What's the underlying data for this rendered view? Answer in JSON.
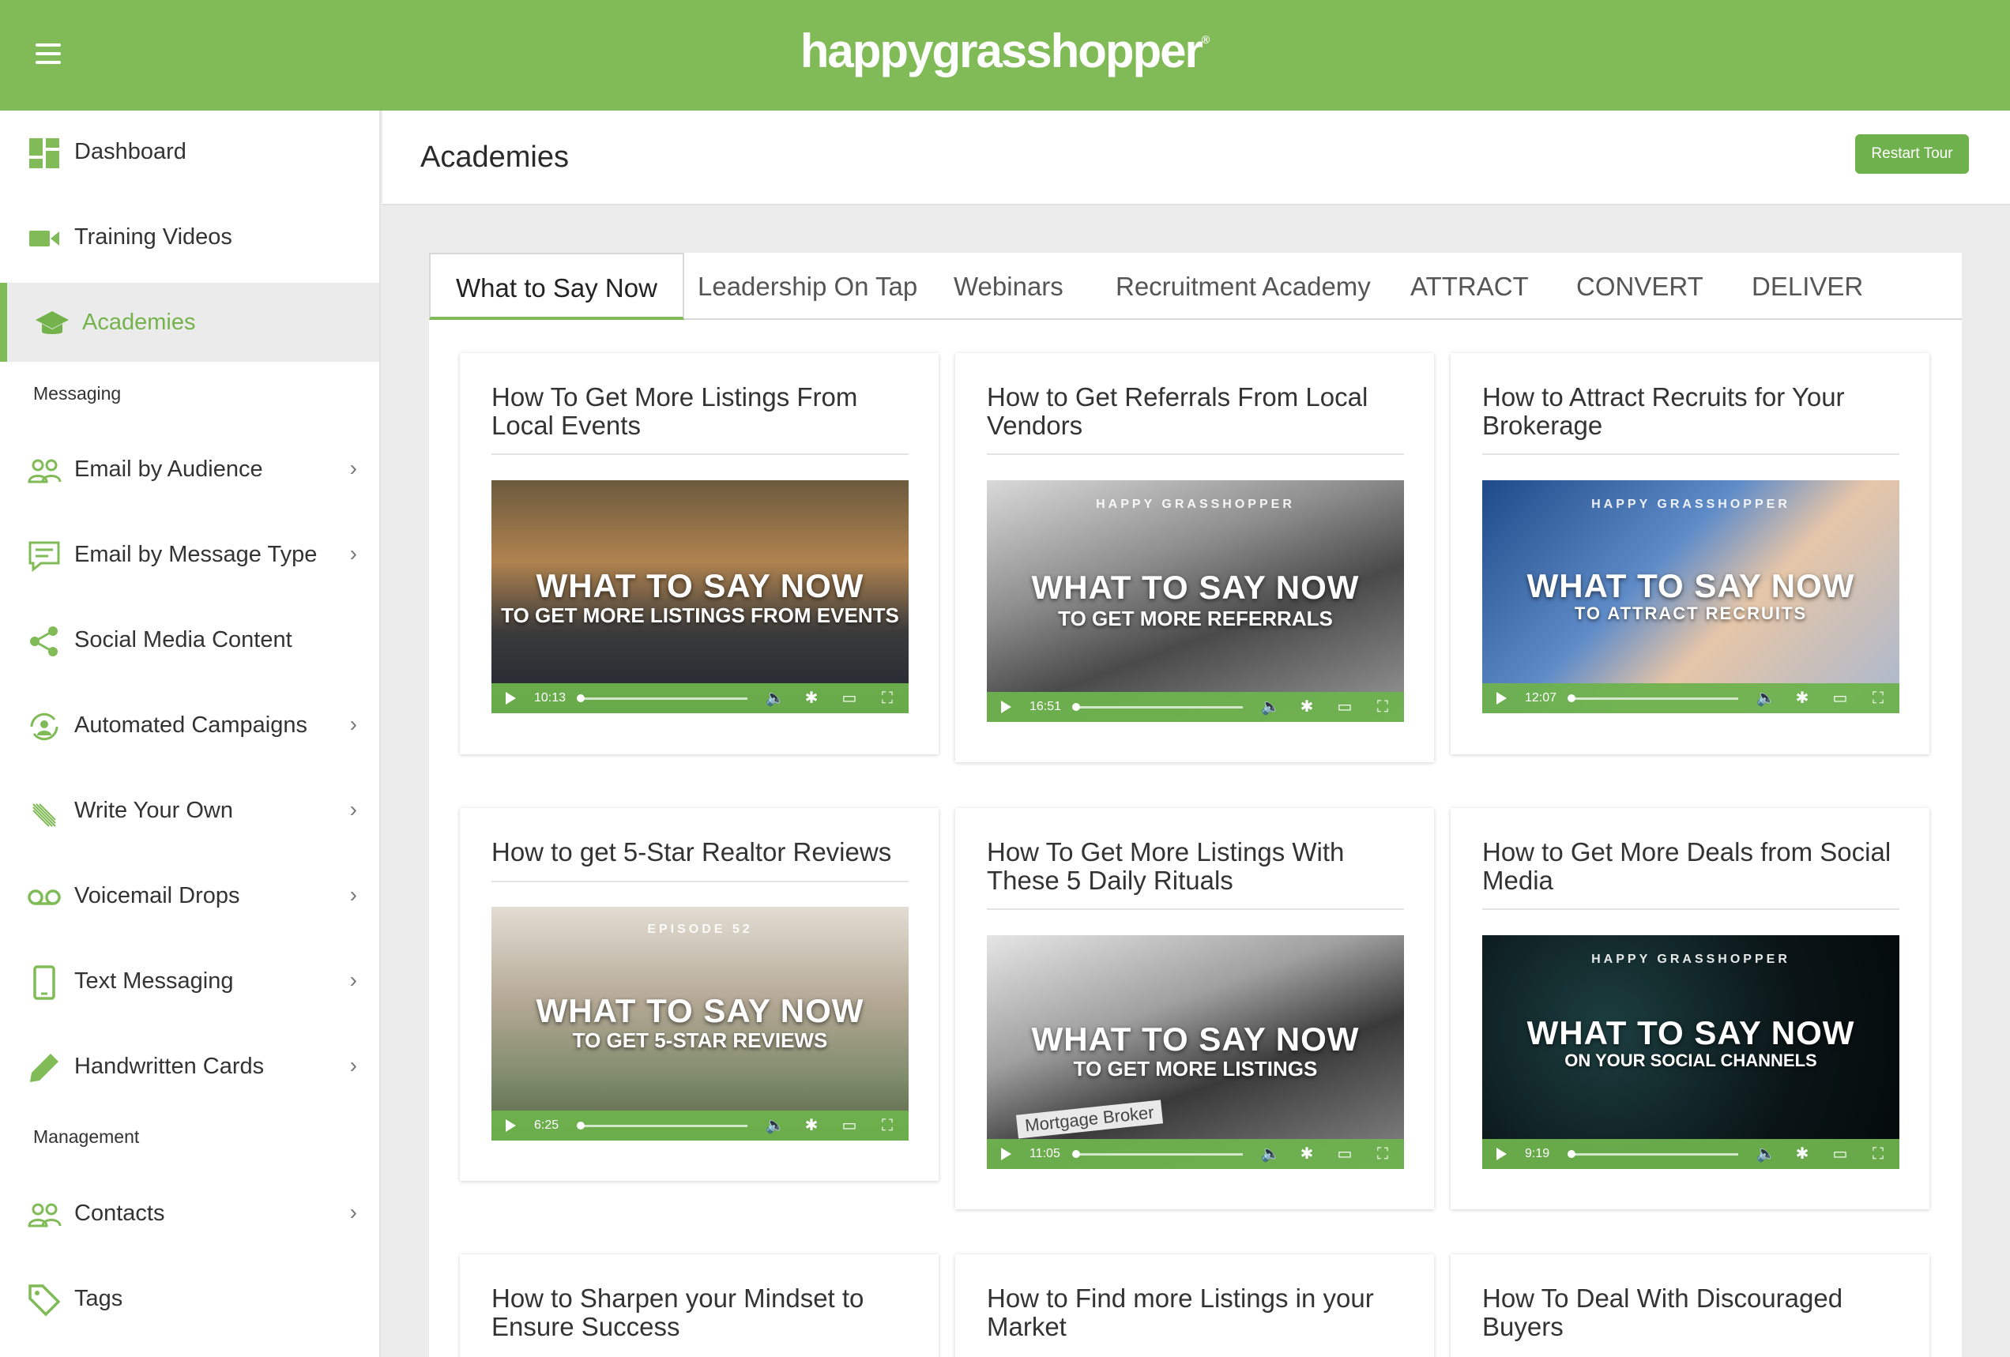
{
  "app": {
    "logo_text": "happygrasshopper",
    "logo_mark": "®"
  },
  "sidebar": {
    "items": [
      {
        "label": "Dashboard",
        "icon": "dashboard-icon"
      },
      {
        "label": "Training Videos",
        "icon": "video-camera-icon"
      },
      {
        "label": "Academies",
        "icon": "graduation-cap-icon",
        "active": true
      },
      {
        "label": "Email by Audience",
        "icon": "people-icon",
        "chevron": true
      },
      {
        "label": "Email by Message Type",
        "icon": "message-icon",
        "chevron": true
      },
      {
        "label": "Social Media Content",
        "icon": "share-icon"
      },
      {
        "label": "Automated Campaigns",
        "icon": "refresh-person-icon",
        "chevron": true
      },
      {
        "label": "Write Your Own",
        "icon": "quill-icon",
        "chevron": true
      },
      {
        "label": "Voicemail Drops",
        "icon": "voicemail-icon",
        "chevron": true
      },
      {
        "label": "Text Messaging",
        "icon": "phone-icon",
        "chevron": true
      },
      {
        "label": "Handwritten Cards",
        "icon": "pen-icon",
        "chevron": true
      },
      {
        "label": "Contacts",
        "icon": "people-icon",
        "chevron": true
      },
      {
        "label": "Tags",
        "icon": "tag-icon"
      }
    ],
    "sections": {
      "messaging": "Messaging",
      "management": "Management"
    },
    "chevron_glyph": "›"
  },
  "header": {
    "title": "Academies",
    "restart_label": "Restart Tour"
  },
  "tabs": [
    "What to Say Now",
    "Leadership On Tap",
    "Webinars",
    "Recruitment Academy",
    "ATTRACT",
    "CONVERT",
    "DELIVER"
  ],
  "colors": {
    "brand_green": "#80bb58",
    "button_green": "#6fb24d"
  },
  "cards": [
    {
      "title": "How To Get More Listings From Local Events",
      "thumb_brand": "",
      "thumb_big": "WHAT TO SAY NOW",
      "thumb_sub": "TO GET MORE LISTINGS FROM EVENTS",
      "duration": "10:13"
    },
    {
      "title": "How to Get Referrals From Local Vendors",
      "thumb_brand": "HAPPY GRASSHOPPER",
      "thumb_big": "WHAT TO SAY NOW",
      "thumb_sub": "TO GET MORE REFERRALS",
      "duration": "16:51"
    },
    {
      "title": "How to Attract Recruits for Your Brokerage",
      "thumb_brand": "HAPPY GRASSHOPPER",
      "thumb_big": "WHAT TO SAY NOW",
      "thumb_sub": "TO ATTRACT RECRUITS",
      "duration": "12:07"
    },
    {
      "title": "How to get 5-Star Realtor Reviews",
      "thumb_brand": "EPISODE 52",
      "thumb_big": "WHAT TO SAY NOW",
      "thumb_sub": "TO GET 5-STAR REVIEWS",
      "duration": "6:25"
    },
    {
      "title": "How To Get More Listings With These 5 Daily Rituals",
      "thumb_brand": "",
      "thumb_big": "WHAT TO SAY NOW",
      "thumb_sub": "TO GET MORE LISTINGS",
      "duration": "11:05",
      "thumb_note": "Mortgage Broker"
    },
    {
      "title": "How to Get More Deals from Social Media",
      "thumb_brand": "HAPPY GRASSHOPPER",
      "thumb_big": "WHAT TO SAY NOW",
      "thumb_sub": "ON YOUR SOCIAL CHANNELS",
      "duration": "9:19"
    },
    {
      "title": "How to Sharpen your Mindset to Ensure Success"
    },
    {
      "title": "How to Find more Listings in your Market"
    },
    {
      "title": "How To Deal With Discouraged Buyers"
    }
  ]
}
